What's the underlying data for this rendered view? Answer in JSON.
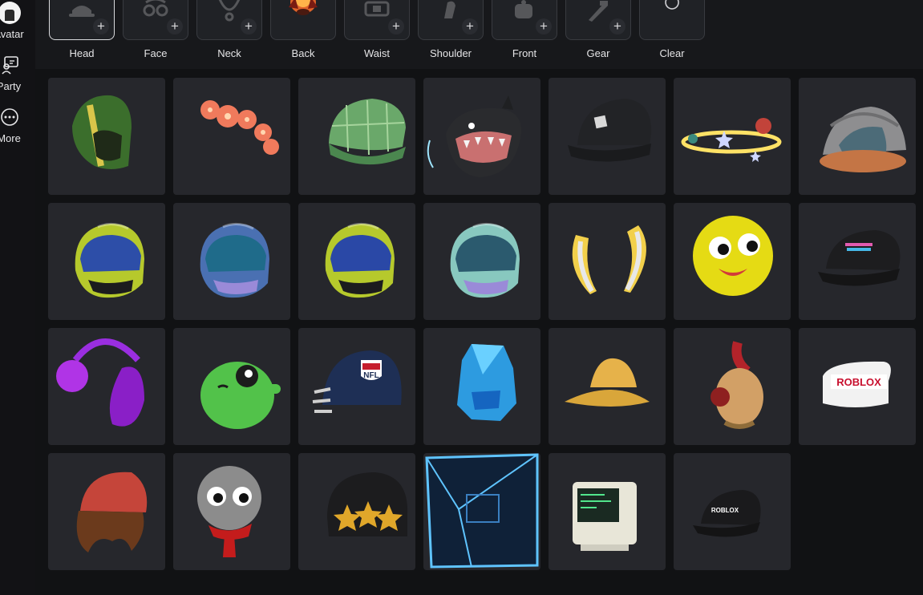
{
  "nav": {
    "items": [
      {
        "label": "Avatar",
        "icon": "avatar-icon"
      },
      {
        "label": "Party",
        "icon": "party-icon"
      },
      {
        "label": "More",
        "icon": "more-icon"
      }
    ]
  },
  "slots": [
    {
      "label": "Head",
      "icon": "hat-icon",
      "active": true
    },
    {
      "label": "Face",
      "icon": "face-accessory-icon"
    },
    {
      "label": "Neck",
      "icon": "necklace-icon"
    },
    {
      "label": "Back",
      "icon": "back-accessory-icon"
    },
    {
      "label": "Waist",
      "icon": "waist-icon"
    },
    {
      "label": "Shoulder",
      "icon": "shoulder-icon"
    },
    {
      "label": "Front",
      "icon": "front-icon"
    },
    {
      "label": "Gear",
      "icon": "gear-icon"
    },
    {
      "label": "Clear",
      "icon": "refresh-icon"
    }
  ],
  "items": [
    {
      "name": "green-hood",
      "icon": "hood-icon"
    },
    {
      "name": "pink-flower-crown",
      "icon": "flower-icon"
    },
    {
      "name": "green-plaid-cap",
      "icon": "cap-icon"
    },
    {
      "name": "orca-hat",
      "icon": "orca-icon"
    },
    {
      "name": "black-roblox-cap",
      "icon": "cap-icon"
    },
    {
      "name": "planet-halo",
      "icon": "halo-icon"
    },
    {
      "name": "dome-helmet",
      "icon": "helmet-icon"
    },
    {
      "name": "yellow-racing-helmet",
      "icon": "helmet-icon"
    },
    {
      "name": "blue-racing-helmet",
      "icon": "helmet-icon"
    },
    {
      "name": "yellow-racing-helmet-2",
      "icon": "helmet-icon"
    },
    {
      "name": "teal-racing-helmet",
      "icon": "helmet-icon"
    },
    {
      "name": "banana-horns",
      "icon": "horns-icon"
    },
    {
      "name": "tennis-ball-face",
      "icon": "face-icon"
    },
    {
      "name": "black-event-cap",
      "icon": "cap-icon"
    },
    {
      "name": "purple-headphones",
      "icon": "headphones-icon"
    },
    {
      "name": "green-alien-head",
      "icon": "alien-icon"
    },
    {
      "name": "nfl-helmet",
      "icon": "helmet-icon"
    },
    {
      "name": "blue-crystal-head",
      "icon": "crystal-icon"
    },
    {
      "name": "yellow-bucket-hat",
      "icon": "bucket-hat-icon"
    },
    {
      "name": "red-feather-helm",
      "icon": "helm-icon"
    },
    {
      "name": "roblox-visor",
      "icon": "visor-icon"
    },
    {
      "name": "red-beanie-hair",
      "icon": "beanie-icon"
    },
    {
      "name": "microphone-head",
      "icon": "microphone-icon"
    },
    {
      "name": "star-beanie",
      "icon": "beanie-icon"
    },
    {
      "name": "glowing-box",
      "icon": "box-icon"
    },
    {
      "name": "retro-computer-head",
      "icon": "computer-icon"
    },
    {
      "name": "black-roblox-cap-2",
      "icon": "cap-icon"
    }
  ],
  "tile_labels": {
    "nfl": "NFL",
    "roblox": "ROBLOX"
  },
  "colors": {
    "background": "#121215",
    "panel": "#17181b",
    "tile": "#26272c",
    "active_border": "#d9dadd"
  }
}
